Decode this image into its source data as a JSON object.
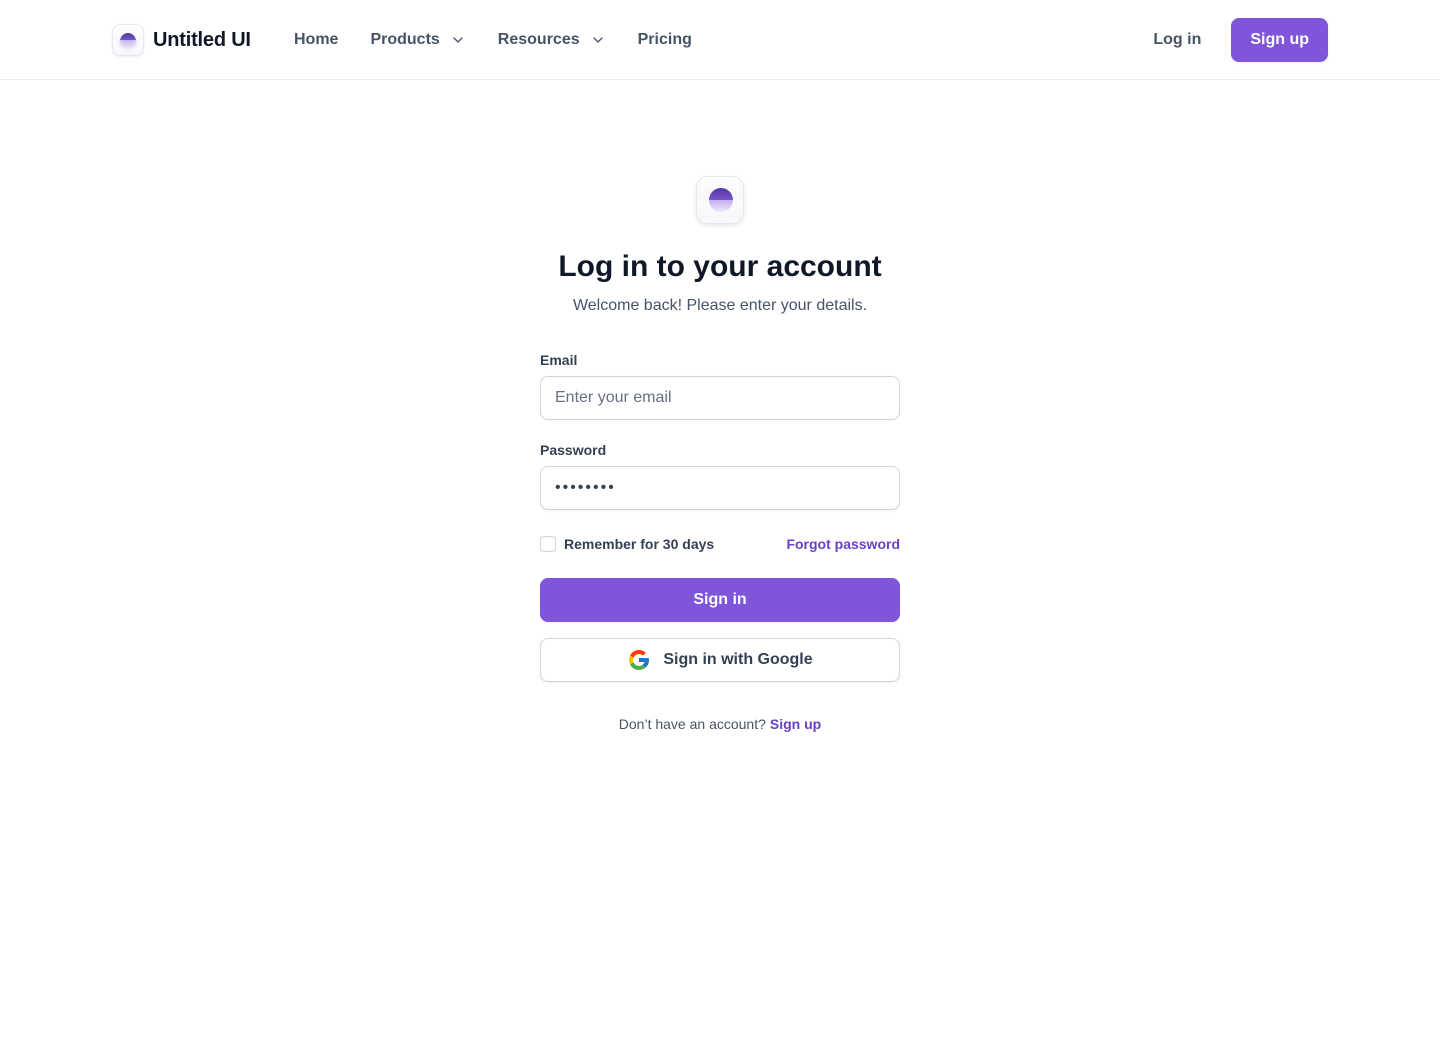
{
  "header": {
    "brand_name": "Untitled UI",
    "nav": [
      {
        "label": "Home",
        "has_dropdown": false
      },
      {
        "label": "Products",
        "has_dropdown": true
      },
      {
        "label": "Resources",
        "has_dropdown": true
      },
      {
        "label": "Pricing",
        "has_dropdown": false
      }
    ],
    "login_label": "Log in",
    "signup_label": "Sign up"
  },
  "login": {
    "title": "Log in to your account",
    "subtitle": "Welcome back! Please enter your details.",
    "email": {
      "label": "Email",
      "placeholder": "Enter your email",
      "value": ""
    },
    "password": {
      "label": "Password",
      "value": "••••••••"
    },
    "remember_label": "Remember for 30 days",
    "remember_checked": false,
    "forgot_label": "Forgot password",
    "signin_label": "Sign in",
    "google_label": "Sign in with Google",
    "footer_prompt": "Don’t have an account?",
    "footer_link": "Sign up"
  },
  "colors": {
    "primary": "#7f56d9",
    "primary_link": "#6941c6",
    "text_heading": "#101828",
    "text_body": "#475467",
    "border": "#d0d5dd"
  },
  "icons": [
    "logo-mark-icon",
    "chevron-down-icon",
    "google-icon"
  ]
}
